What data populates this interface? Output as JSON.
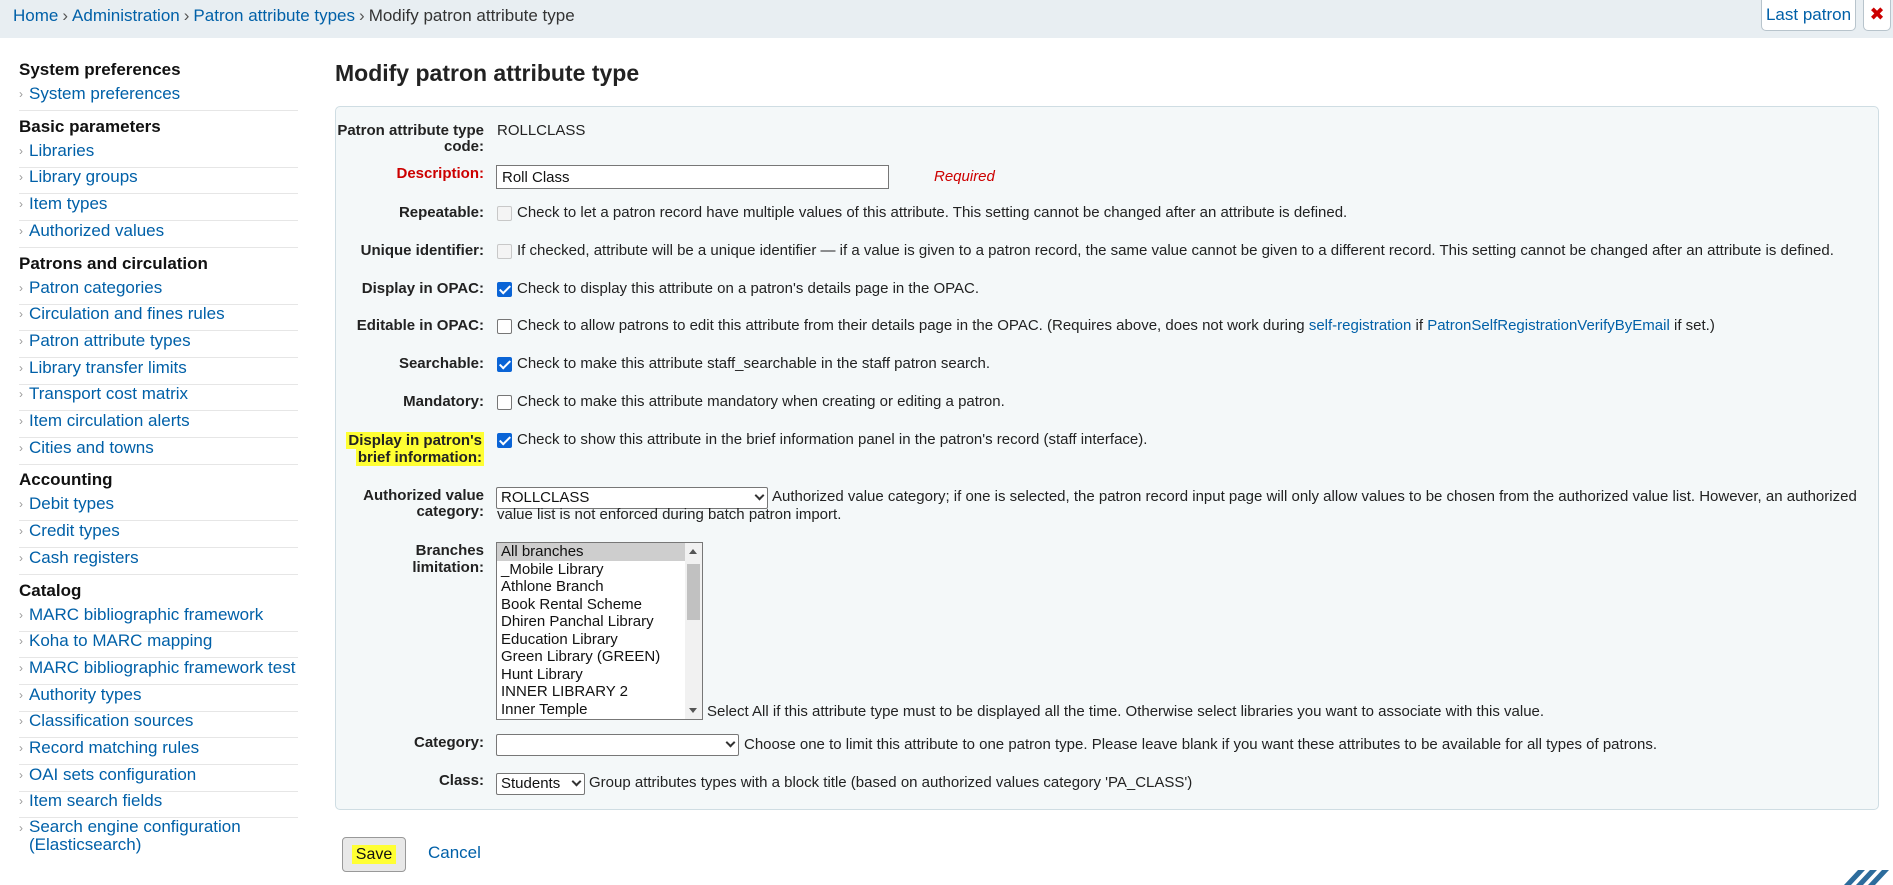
{
  "breadcrumb": {
    "home": "Home",
    "administration": "Administration",
    "patron_attribute_types": "Patron attribute types",
    "current": "Modify patron attribute type",
    "separator": "›"
  },
  "header": {
    "last_patron_label": "Last patron",
    "close_symbol": "✖"
  },
  "sidebar": {
    "sections": [
      {
        "heading": "System preferences",
        "items": [
          "System preferences"
        ]
      },
      {
        "heading": "Basic parameters",
        "items": [
          "Libraries",
          "Library groups",
          "Item types",
          "Authorized values"
        ]
      },
      {
        "heading": "Patrons and circulation",
        "items": [
          "Patron categories",
          "Circulation and fines rules",
          "Patron attribute types",
          "Library transfer limits",
          "Transport cost matrix",
          "Item circulation alerts",
          "Cities and towns"
        ]
      },
      {
        "heading": "Accounting",
        "items": [
          "Debit types",
          "Credit types",
          "Cash registers"
        ]
      },
      {
        "heading": "Catalog",
        "items": [
          "MARC bibliographic framework",
          "Koha to MARC mapping",
          "MARC bibliographic framework test",
          "Authority types",
          "Classification sources",
          "Record matching rules",
          "OAI sets configuration",
          "Item search fields",
          "Search engine configuration (Elasticsearch)"
        ]
      }
    ]
  },
  "main": {
    "title": "Modify patron attribute type",
    "form": {
      "code": {
        "label": "Patron attribute type code:",
        "value": "ROLLCLASS"
      },
      "description": {
        "label": "Description:",
        "value": "Roll Class",
        "required_note": "Required"
      },
      "repeatable": {
        "label": "Repeatable:",
        "hint": "Check to let a patron record have multiple values of this attribute. This setting cannot be changed after an attribute is defined.",
        "checked": false,
        "disabled": true
      },
      "unique": {
        "label": "Unique identifier:",
        "hint": "If checked, attribute will be a unique identifier — if a value is given to a patron record, the same value cannot be given to a different record. This setting cannot be changed after an attribute is defined.",
        "checked": false,
        "disabled": true
      },
      "display_opac": {
        "label": "Display in OPAC:",
        "hint": "Check to display this attribute on a patron's details page in the OPAC.",
        "checked": true
      },
      "editable_opac": {
        "label": "Editable in OPAC:",
        "hint_before": "Check to allow patrons to edit this attribute from their details page in the OPAC. (Requires above, does not work during",
        "link1": "self-registration",
        "hint_mid": "if",
        "link2": "PatronSelfRegistrationVerifyByEmail",
        "hint_after": "if set.)",
        "checked": false
      },
      "searchable": {
        "label": "Searchable:",
        "hint": "Check to make this attribute staff_searchable in the staff patron search.",
        "checked": true
      },
      "mandatory": {
        "label": "Mandatory:",
        "hint": "Check to make this attribute mandatory when creating or editing a patron.",
        "checked": false
      },
      "brief_info": {
        "label_line1": "Display in patron's",
        "label_line2": "brief information:",
        "hint": "Check to show this attribute in the brief information panel in the patron's record (staff interface).",
        "checked": true
      },
      "authorized_value": {
        "label_line1": "Authorized value",
        "label_line2": "category:",
        "selected": "ROLLCLASS",
        "hint_line1": "Authorized value category; if one is selected, the patron record input page will only allow values to be chosen from the authorized value list. However, an authorized",
        "hint_line2": "value list is not enforced during batch patron import."
      },
      "branches": {
        "label_line1": "Branches",
        "label_line2": "limitation:",
        "options": [
          "All branches",
          "_Mobile Library",
          "Athlone Branch",
          "Book Rental Scheme",
          "Dhiren Panchal Library",
          "Education Library",
          "Green Library (GREEN)",
          "Hunt Library",
          "INNER LIBRARY 2",
          "Inner Temple"
        ],
        "selected_index": 0,
        "hint": "Select All if this attribute type must to be displayed all the time. Otherwise select libraries you want to associate with this value."
      },
      "category": {
        "label": "Category:",
        "selected": "",
        "hint": "Choose one to limit this attribute to one patron type. Please leave blank if you want these attributes to be available for all types of patrons."
      },
      "class": {
        "label": "Class:",
        "selected": "Students",
        "hint": "Group attributes types with a block title (based on authorized values category 'PA_CLASS')"
      }
    },
    "actions": {
      "save_label": "Save",
      "cancel_label": "Cancel"
    }
  },
  "colors": {
    "link": "#0060a8",
    "highlight": "#ffff33",
    "required": "#cc0000",
    "checkbox_checked": "#0a64d6",
    "panel_background": "#f4f8f9"
  },
  "icons": {
    "sidebar_chevron": "chevron-right-icon",
    "close": "close-icon",
    "corner": "koha-logo-icon"
  }
}
